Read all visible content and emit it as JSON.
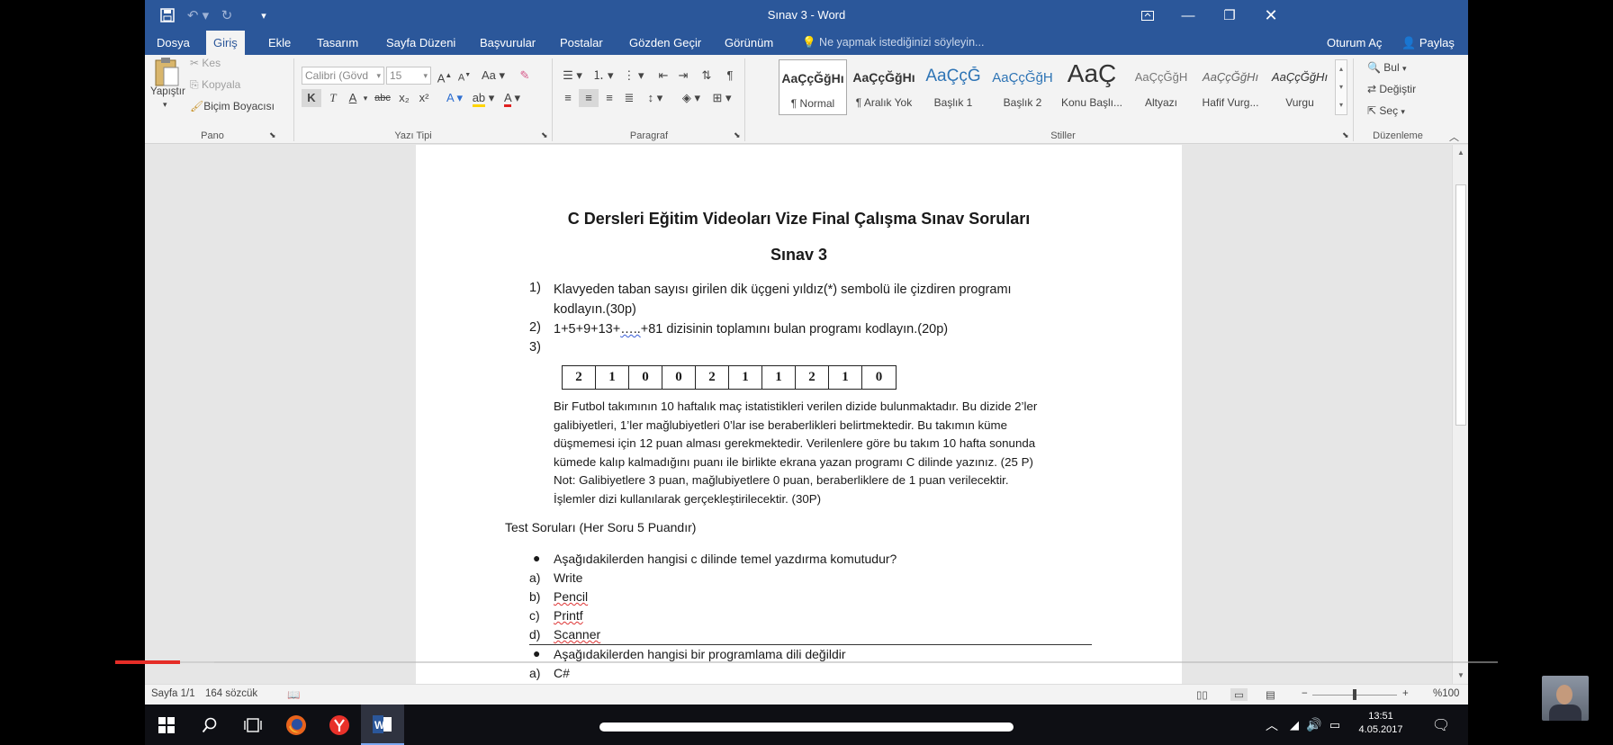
{
  "titlebar": {
    "title": "Sınav 3 - Word",
    "save_icon": "save-icon",
    "undo_icon": "undo-icon",
    "redo_icon": "redo-icon",
    "customize_icon": "customize-qa-icon"
  },
  "tabs": [
    {
      "label": "Dosya"
    },
    {
      "label": "Giriş"
    },
    {
      "label": "Ekle"
    },
    {
      "label": "Tasarım"
    },
    {
      "label": "Sayfa Düzeni"
    },
    {
      "label": "Başvurular"
    },
    {
      "label": "Postalar"
    },
    {
      "label": "Gözden Geçir"
    },
    {
      "label": "Görünüm"
    }
  ],
  "tell_me": "Ne yapmak istediğinizi söyleyin...",
  "account": {
    "signin": "Oturum Aç",
    "share": "Paylaş"
  },
  "ribbon": {
    "clipboard": {
      "paste": "Yapıştır",
      "cut": "Kes",
      "copy": "Kopyala",
      "format_painter": "Biçim Boyacısı",
      "label": "Pano"
    },
    "font": {
      "name": "Calibri (Gövd",
      "size": "15",
      "label": "Yazı Tipi",
      "bold": "K",
      "italic": "T",
      "underline": "A",
      "strike": "abc",
      "sub": "x₂",
      "sup": "x²"
    },
    "paragraph": {
      "label": "Paragraf"
    },
    "styles": {
      "label": "Stiller",
      "items": [
        {
          "sample": "AaÇçĞğHı",
          "name": "¶ Normal"
        },
        {
          "sample": "AaÇçĞğHı",
          "name": "¶ Aralık Yok"
        },
        {
          "sample": "AaÇçĞ",
          "name": "Başlık 1"
        },
        {
          "sample": "AaÇçĞğH",
          "name": "Başlık 2"
        },
        {
          "sample": "AaÇ",
          "name": "Konu Başlı..."
        },
        {
          "sample": "AaÇçĞğH",
          "name": "Altyazı"
        },
        {
          "sample": "AaÇçĞğHı",
          "name": "Hafif Vurg..."
        },
        {
          "sample": "AaÇçĞğHı",
          "name": "Vurgu"
        }
      ]
    },
    "editing": {
      "find": "Bul",
      "replace": "Değiştir",
      "select": "Seç",
      "label": "Düzenleme"
    }
  },
  "document": {
    "title": "C Dersleri Eğitim Videoları Vize Final Çalışma Sınav Soruları",
    "subtitle": "Sınav 3",
    "questions": [
      {
        "num": "1)",
        "lines": [
          "Klavyeden taban sayısı girilen dik üçgeni yıldız(*) sembolü ile çizdiren programı",
          "kodlayın.(30p)"
        ]
      },
      {
        "num": "2)",
        "pre": "1+5+9+13+",
        "squig": "…..",
        "post": "+81 dizisinin toplamını bulan programı kodlayın.(20p)"
      },
      {
        "num": "3)"
      }
    ],
    "sequence": [
      "2",
      "1",
      "0",
      "0",
      "2",
      "1",
      "1",
      "2",
      "1",
      "0"
    ],
    "paragraph_lines": [
      "Bir Futbol takımının 10 haftalık maç istatistikleri verilen dizide bulunmaktadır. Bu dizide 2’ler",
      "galibiyetleri, 1’ler mağlubiyetleri 0’lar ise beraberlikleri belirtmektedir. Bu takımın küme",
      "düşmemesi için 12 puan alması gerekmektedir. Verilenlere göre bu takım 10 hafta sonunda",
      "kümede kalıp kalmadığını puanı ile birlikte ekrana yazan programı C dilinde yazınız. (25 P)",
      "Not: Galibiyetlere 3 puan, mağlubiyetlere 0 puan, beraberliklere de 1 puan verilecektir.",
      "İşlemler dizi kullanılarak gerçekleştirilecektir. (30P)"
    ],
    "test_heading": "Test Soruları (Her Soru 5 Puandır)",
    "test_q1": "Aşağıdakilerden hangisi c dilinde temel yazdırma komutudur?",
    "test_q1_options": [
      {
        "letter": "a)",
        "text": "Write"
      },
      {
        "letter": "b)",
        "text": "Pencil"
      },
      {
        "letter": "c)",
        "text": "Printf"
      },
      {
        "letter": "d)",
        "text": "Scanner"
      }
    ],
    "test_q2": "Aşağıdakilerden hangisi bir programlama dili değildir",
    "test_q2_options": [
      {
        "letter": "a)",
        "text": "C#"
      }
    ]
  },
  "statusbar": {
    "page": "Sayfa 1/1",
    "words": "164 sözcük",
    "zoom": "%100"
  },
  "video": {
    "progress_fraction": 0.047
  },
  "taskbar": {
    "time": "13:51",
    "date": "4.05.2017"
  }
}
